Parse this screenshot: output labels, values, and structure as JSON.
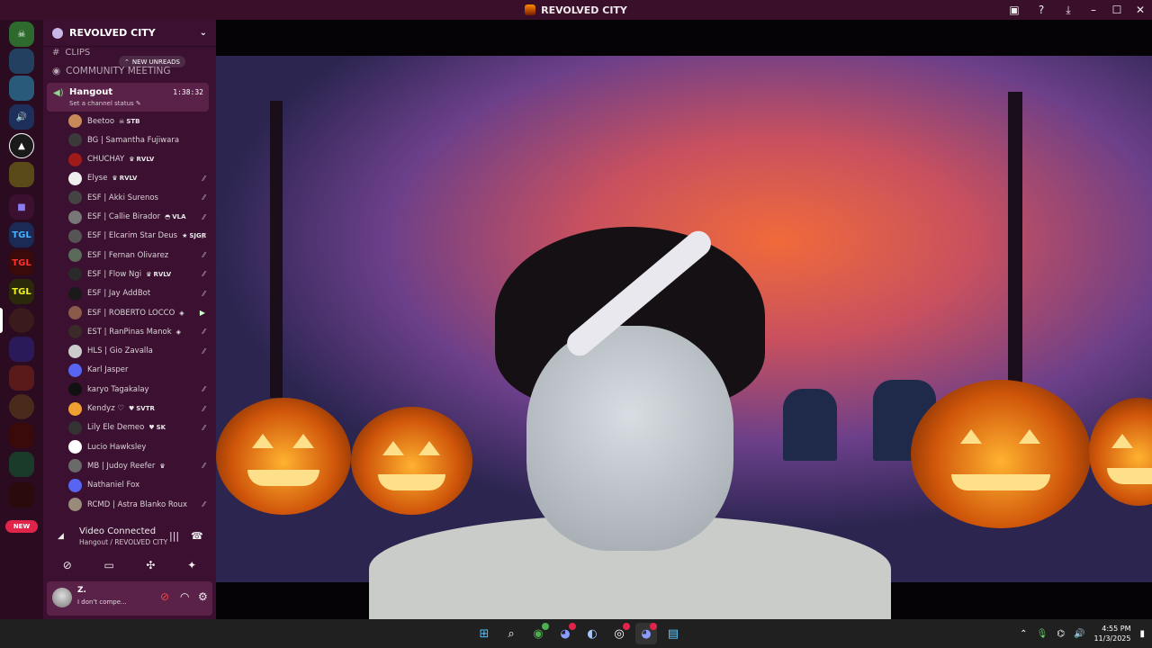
{
  "window": {
    "title": "REVOLVED CITY",
    "theme_bg": "#3a0f2a"
  },
  "sidebar": {
    "guild_name": "REVOLVED CITY",
    "clips_channel": "CLIPS",
    "new_unreads": "NEW UNREADS",
    "meeting_channel": "COMMUNITY MEETING",
    "voice_channel": "Hangout",
    "voice_timer": "1:38:32",
    "voice_status": "Set a channel status",
    "new_badge": "NEW"
  },
  "members": [
    {
      "name": "Beetoo",
      "tag": "STB",
      "tag_icon": "skull-icon",
      "icon": "",
      "av": "#c98a5a"
    },
    {
      "name": "BG | Samantha Fujiwara",
      "tag": "",
      "tag_icon": "",
      "icon": "",
      "av": "#3a3a3a"
    },
    {
      "name": "CHUCHAY",
      "tag": "RVLV",
      "tag_icon": "trophy-icon",
      "icon": "",
      "av": "#a11a1a"
    },
    {
      "name": "Elyse",
      "tag": "RVLV",
      "tag_icon": "trophy-icon",
      "icon": "deafened-icon",
      "av": "#eeeeee"
    },
    {
      "name": "ESF | Akki Surenos",
      "tag": "",
      "tag_icon": "",
      "icon": "deafened-icon",
      "av": "#444444"
    },
    {
      "name": "ESF | Callie Birador",
      "tag": "VLA",
      "tag_icon": "ghost-icon",
      "icon": "deafened-icon",
      "av": "#777777"
    },
    {
      "name": "ESF | Elcarim Star Deus",
      "tag": "SJGR",
      "tag_icon": "star-icon",
      "icon": "deafened-icon",
      "av": "#555555"
    },
    {
      "name": "ESF | Fernan Olivarez",
      "tag": "",
      "tag_icon": "",
      "icon": "deafened-icon",
      "av": "#5a6b5a"
    },
    {
      "name": "ESF | Flow Ngi",
      "tag": "RVLV",
      "tag_icon": "trophy-icon",
      "icon": "deafened-icon",
      "av": "#2a2a2a"
    },
    {
      "name": "ESF | Jay AddBot",
      "tag": "",
      "tag_icon": "",
      "icon": "deafened-icon",
      "av": "#1a1a1a"
    },
    {
      "name": "ESF | ROBERTO LOCCO",
      "tag": "",
      "tag_icon": "badge-icon",
      "icon": "camera-icon",
      "av": "#8a5a4a"
    },
    {
      "name": "EST | RanPinas Manok",
      "tag": "",
      "tag_icon": "badge-icon",
      "icon": "deafened-icon",
      "av": "#3a2a2a"
    },
    {
      "name": "HLS | Gio Zavalla",
      "tag": "",
      "tag_icon": "",
      "icon": "deafened-icon",
      "av": "#cccccc"
    },
    {
      "name": "Karl Jasper",
      "tag": "",
      "tag_icon": "",
      "icon": "",
      "av": "#5865f2"
    },
    {
      "name": "karyo Tagakalay",
      "tag": "",
      "tag_icon": "",
      "icon": "deafened-icon",
      "av": "#111111"
    },
    {
      "name": "Kendyz ♡",
      "tag": "SVTR",
      "tag_icon": "heart-icon",
      "icon": "deafened-icon",
      "av": "#f0a030"
    },
    {
      "name": "Lily Ele Demeo",
      "tag": "SK",
      "tag_icon": "heart-icon",
      "icon": "deafened-icon",
      "av": "#333333"
    },
    {
      "name": "Lucio Hawksley",
      "tag": "",
      "tag_icon": "",
      "icon": "",
      "av": "#ffffff"
    },
    {
      "name": "MB | Judoy Reefer",
      "tag": "",
      "tag_icon": "trophy-icon",
      "icon": "deafened-icon",
      "av": "#6a6a6a"
    },
    {
      "name": "Nathaniel Fox",
      "tag": "",
      "tag_icon": "",
      "icon": "",
      "av": "#5865f2"
    },
    {
      "name": "RCMD | Astra Blanko Roux",
      "tag": "",
      "tag_icon": "",
      "icon": "deafened-icon",
      "av": "#9a8a7a"
    }
  ],
  "voice": {
    "title": "Video Connected",
    "subtitle": "Hangout / REVOLVED CITY"
  },
  "user": {
    "name": "Z.",
    "status": "I don't compe..."
  },
  "taskbar": {
    "time": "4:55 PM",
    "date": "11/3/2025"
  }
}
